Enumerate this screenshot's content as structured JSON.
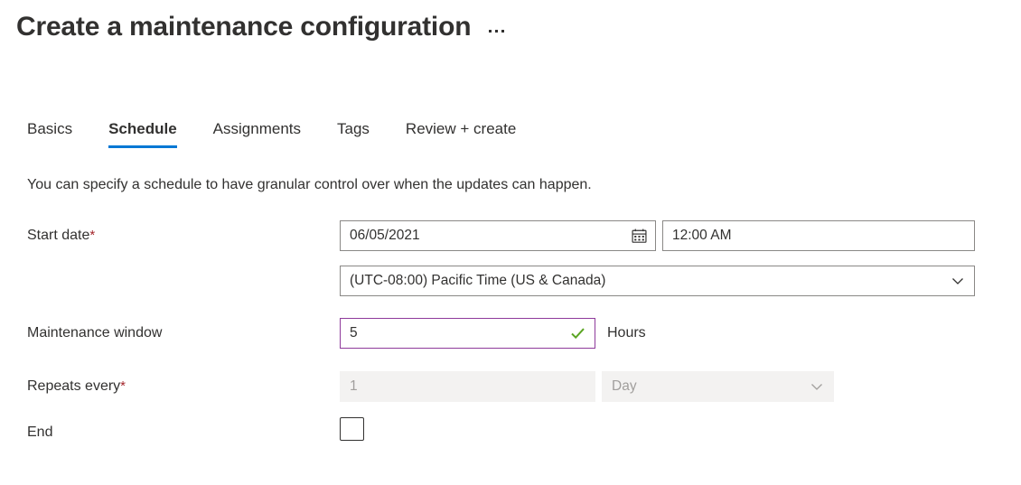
{
  "header": {
    "title": "Create a maintenance configuration",
    "more_menu_label": "..."
  },
  "tabs": [
    {
      "label": "Basics",
      "active": false
    },
    {
      "label": "Schedule",
      "active": true
    },
    {
      "label": "Assignments",
      "active": false
    },
    {
      "label": "Tags",
      "active": false
    },
    {
      "label": "Review + create",
      "active": false
    }
  ],
  "description": "You can specify a schedule to have granular control over when the updates can happen.",
  "form": {
    "start_date": {
      "label": "Start date",
      "required_marker": "*",
      "date_value": "06/05/2021",
      "date_placeholder": "mm/dd/yyyy",
      "calendar_icon": "calendar-icon",
      "time_value": "12:00 AM",
      "time_placeholder": "hh:mm AM",
      "timezone_value": "(UTC-08:00) Pacific Time (US & Canada)",
      "timezone_chevron_icon": "chevron-down-icon"
    },
    "maintenance_window": {
      "label": "Maintenance window",
      "value": "5",
      "placeholder": "",
      "validation_icon": "checkmark-icon",
      "suffix": "Hours"
    },
    "repeats_every": {
      "label": "Repeats every",
      "required_marker": "*",
      "number_value": "1",
      "unit_value": "Day",
      "unit_chevron_icon": "chevron-down-icon",
      "disabled": true
    },
    "end": {
      "label": "End",
      "checked": false
    }
  },
  "colors": {
    "accent": "#0078d4",
    "required": "#a4262c",
    "focus_border": "#8e3a9b",
    "valid_check": "#5ba524",
    "text": "#323130",
    "disabled_text": "#a19f9d",
    "disabled_bg": "#f3f2f1",
    "border": "#8a8886"
  }
}
